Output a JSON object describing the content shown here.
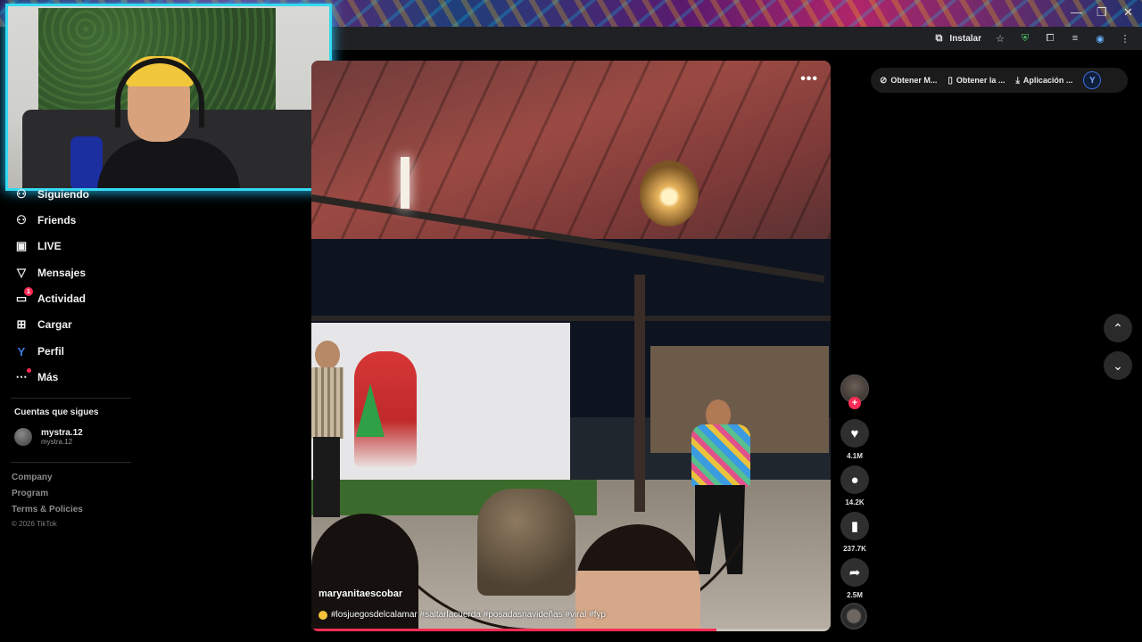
{
  "browser": {
    "install_label": "Instalar",
    "window_controls": [
      "—",
      "❐",
      "✕"
    ],
    "toolbar_icons": [
      "star-icon",
      "shield-icon",
      "puzzle-icon",
      "playlist-icon",
      "profile-icon",
      "menu-icon"
    ]
  },
  "sidebar": {
    "items": [
      {
        "label": "Siguiendo",
        "icon": "following-icon"
      },
      {
        "label": "Friends",
        "icon": "friends-icon"
      },
      {
        "label": "LIVE",
        "icon": "live-icon"
      },
      {
        "label": "Mensajes",
        "icon": "messages-icon"
      },
      {
        "label": "Actividad",
        "icon": "activity-icon",
        "badge": "1"
      },
      {
        "label": "Cargar",
        "icon": "upload-icon"
      },
      {
        "label": "Perfil",
        "icon": "profile-icon"
      },
      {
        "label": "Más",
        "icon": "more-icon"
      }
    ],
    "following_title": "Cuentas que sigues",
    "following_accounts": [
      {
        "name": "mystra.12",
        "handle": "mystra.12"
      }
    ],
    "footer_links": [
      "Company",
      "Program",
      "Terms & Policies"
    ],
    "copyright": "© 2026 TikTok"
  },
  "video": {
    "author": "maryanitaescobar",
    "caption": "#losjuegosdelcalamar #saltarlacuerda #posadasnavideñas #viral #fyp",
    "more_label": "•••",
    "progress_fraction": 0.78
  },
  "actions": {
    "likes": "4.1M",
    "comments": "14.2K",
    "saves": "237.7K",
    "shares": "2.5M"
  },
  "top_pills": [
    {
      "label": "Obtener M...",
      "icon": "coin-icon"
    },
    {
      "label": "Obtener la ...",
      "icon": "phone-icon"
    },
    {
      "label": "Aplicación ...",
      "icon": "download-icon"
    }
  ],
  "colors": {
    "accent": "#fe2c55",
    "webcam_border": "#34d9f0"
  }
}
